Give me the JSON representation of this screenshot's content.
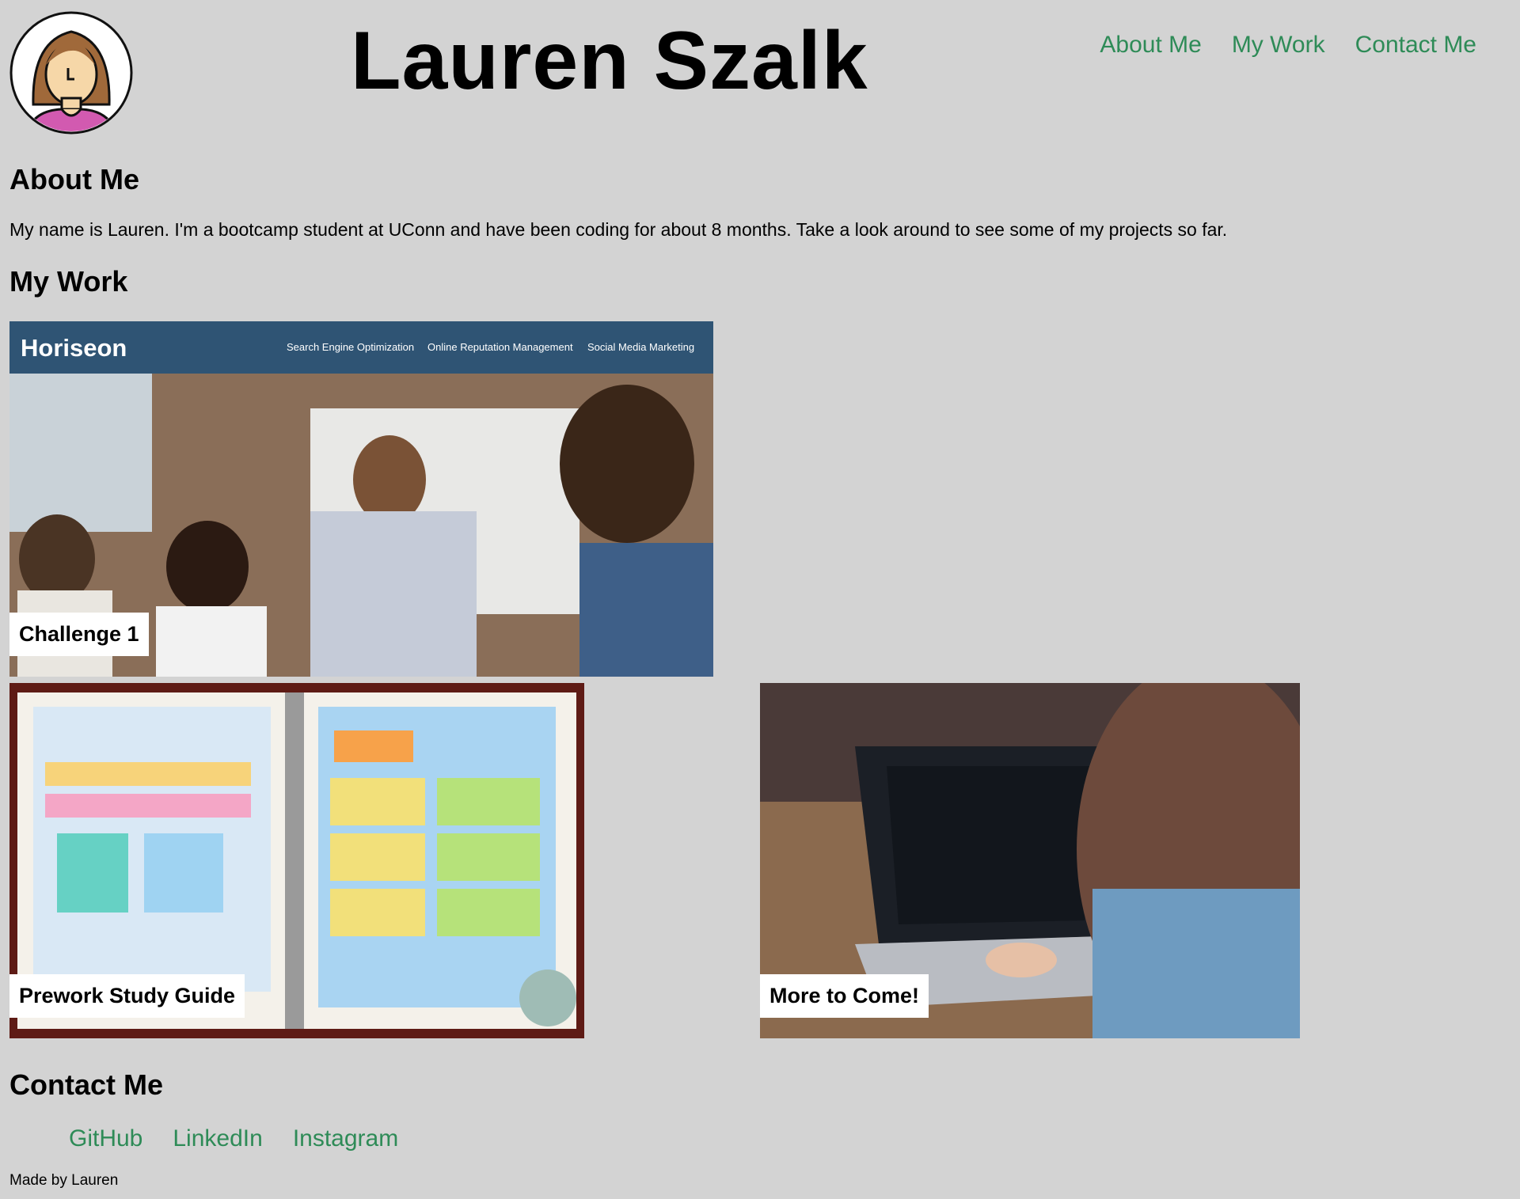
{
  "header": {
    "title": "Lauren Szalk",
    "nav": [
      {
        "label": "About Me"
      },
      {
        "label": "My Work"
      },
      {
        "label": "Contact Me"
      }
    ]
  },
  "about": {
    "heading": "About Me",
    "text": "My name is Lauren. I'm a bootcamp student at UConn and have been coding for about 8 months. Take a look around to see some of my projects so far."
  },
  "work": {
    "heading": "My Work",
    "tiles": [
      {
        "label": "Challenge 1",
        "screenshot": {
          "brand": "Horiseon",
          "nav": [
            "Search Engine Optimization",
            "Online Reputation Management",
            "Social Media Marketing"
          ]
        }
      },
      {
        "label": "Prework Study Guide"
      },
      {
        "label": "More to Come!"
      }
    ]
  },
  "contact": {
    "heading": "Contact Me",
    "links": [
      {
        "label": "GitHub"
      },
      {
        "label": "LinkedIn"
      },
      {
        "label": "Instagram"
      }
    ]
  },
  "footer": {
    "text": "Made by Lauren"
  },
  "colors": {
    "background": "#d3d3d3",
    "link": "#2e8b57",
    "label_bg": "#ffffff"
  }
}
